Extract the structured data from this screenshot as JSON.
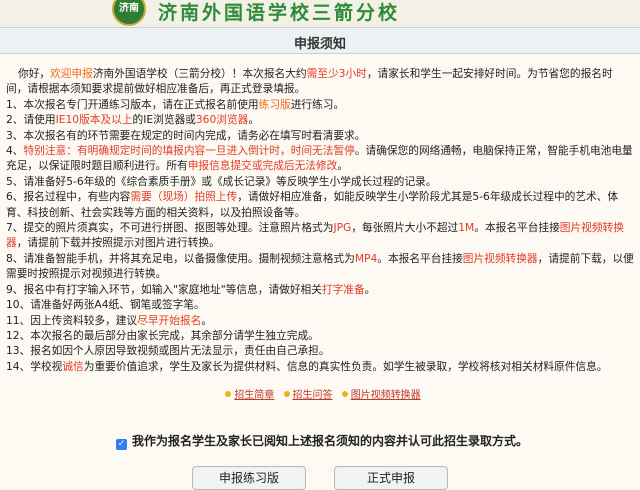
{
  "header": {
    "logo_text": "济南",
    "school_name": "济南外国语学校三箭分校"
  },
  "title": "申报须知",
  "intro": {
    "a": "你好，",
    "b": "欢迎申报",
    "c": "济南外国语学校（三箭分校）！本次报名大约",
    "d": "需至少3小时",
    "e": "，请家长和学生一起安排好时间。为节省您的报名时间，请根据本须知要求提前做好相应准备后，再正式登录填报。"
  },
  "items": [
    {
      "a": "1、本次报名专门开通练习版本，请在正式报名前使用",
      "b": "练习版",
      "c": "进行练习。"
    },
    {
      "a": "2、请使用",
      "b": "IE10版本及以上",
      "c": "的IE浏览器或",
      "d": "360浏览器",
      "e": "。"
    },
    {
      "a": "3、本次报名有的环节需要在规定的时间内完成，请务必在填写时看清要求。"
    },
    {
      "a": "4、",
      "b": "特别注意：有明确规定时间的填报内容一旦进入倒计时，时间无法暂停",
      "c": "。请确保您的网络通畅，电脑保持正常，智能手机电池电量充足，以保证限时题目顺利进行。所有",
      "d": "申报信息提交或完成后无法修改",
      "e": "。"
    },
    {
      "a": "5、请准备好5-6年级的《综合素质手册》或《成长记录》等反映学生小学成长过程的记录。"
    },
    {
      "a": "6、报名过程中，有些内容",
      "b": "需要（现场）拍照上传",
      "c": "，请做好相应准备，如能反映学生小学阶段尤其是5-6年级成长过程中的艺术、体育、科技创新、社会实践等方面的相关资料，以及拍照设备等。"
    },
    {
      "a": "7、提交的照片须真实，不可进行拼图、抠图等处理。注意照片格式为",
      "b": "JPG",
      "c": "，每张照片大小不超过",
      "d": "1M",
      "e": "。本报名平台挂接",
      "f": "图片视频转换器",
      "g": "，请提前下载并按照提示对图片进行转换。"
    },
    {
      "a": "8、请准备智能手机，并将其充足电，以备摄像使用。摄制视频注意格式为",
      "b": "MP4",
      "c": "。本报名平台挂接",
      "d": "图片视频转换器",
      "e": "，请提前下载，以便需要时按照提示对视频进行转换。"
    },
    {
      "a": "9、报名中有打字输入环节，如输入\"家庭地址\"等信息，请做好相关",
      "b": "打字准备",
      "c": "。"
    },
    {
      "a": "10、请准备好两张A4纸、钢笔或签字笔。"
    },
    {
      "a": "11、因上传资料较多，建议",
      "b": "尽早开始报名",
      "c": "。"
    },
    {
      "a": "12、本次报名的最后部分由家长完成，其余部分请学生独立完成。"
    },
    {
      "a": "13、报名如因个人原因导致视频或图片无法显示，责任由自己承担。"
    },
    {
      "a": "14、学校视",
      "b": "诚信",
      "c": "为重要价值追求，学生及家长为提供材料、信息的真实性负责。如学生被录取，学校将核对相关材料原件信息。"
    }
  ],
  "links": [
    "招生简章",
    "招生问答",
    "图片视频转换器"
  ],
  "agree_text": "我作为报名学生及家长已阅知上述报名须知的内容并认可此招生录取方式。",
  "buttons": {
    "practice": "申报练习版",
    "formal": "正式申报"
  }
}
